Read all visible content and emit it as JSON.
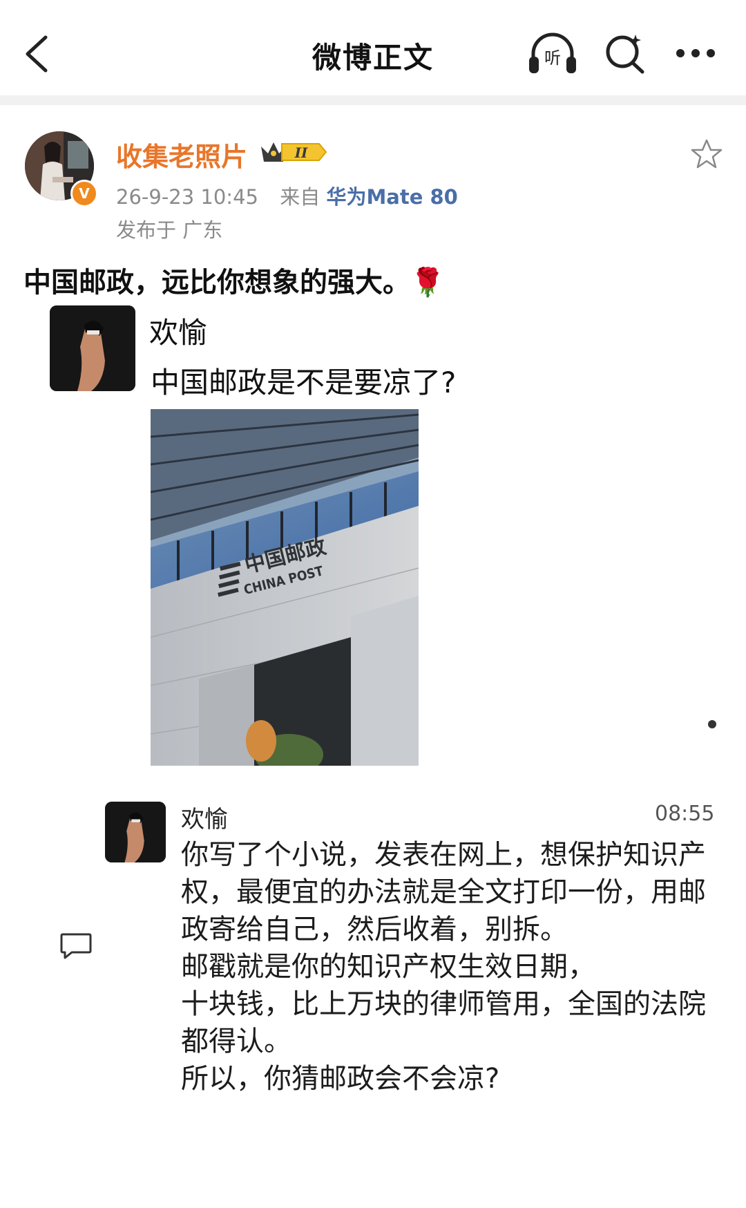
{
  "nav": {
    "title": "微博正文",
    "listen_label": "听"
  },
  "author": {
    "name": "收集老照片",
    "level": "II",
    "verified_mark": "V",
    "time": "26-9-23 10:45",
    "source_prefix": "来自",
    "device": "华为Mate 80",
    "location": "发布于 广东"
  },
  "post": {
    "text": "中国邮政，远比你想象的强大。🌹"
  },
  "embedded": {
    "message1": {
      "name": "欢愉",
      "text": "中国邮政是不是要凉了?"
    },
    "photo": {
      "sign_cn": "中国邮政",
      "sign_en": "CHINA POST"
    },
    "message2": {
      "name": "欢愉",
      "time": "08:55",
      "lines": [
        "你写了个小说，发表在网上，想保护知识产",
        "权，最便宜的办法就是全文打印一份，用邮",
        "政寄给自己，然后收着，别拆。",
        "邮戳就是你的知识产权生效日期，",
        "十块钱，比上万块的律师管用，全国的法院",
        "都得认。",
        "所以，你猜邮政会不会凉?"
      ]
    }
  },
  "icons": {
    "back": "chevron-left-icon",
    "listen": "headphones-icon",
    "search": "search-icon",
    "more": "more-dots-icon",
    "favorite": "star-outline-icon",
    "comment": "comment-bubble-icon",
    "level": "crown-level-icon"
  },
  "colors": {
    "author_name": "#e8762b",
    "device_link": "#4a6ea8",
    "meta_gray": "#8a8a8a",
    "verified": "#f08a1c"
  }
}
